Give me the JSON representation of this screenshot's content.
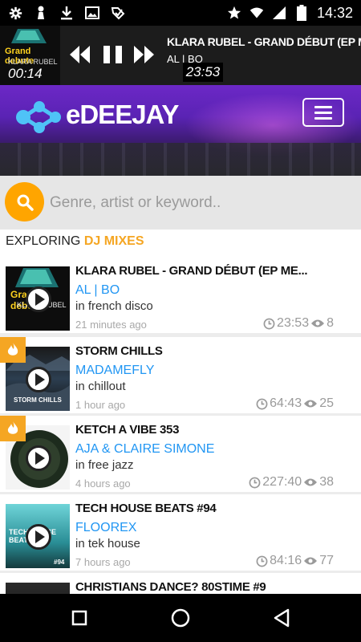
{
  "status_bar": {
    "time": "14:32"
  },
  "player": {
    "art_title": "Grand debute",
    "art_artist": "KLARA RUBEL",
    "elapsed": "00:14",
    "title": "KLARA RUBEL - GRAND DÉBUT (EP MEGAMIX)",
    "artist": "AL | BO",
    "duration": "23:53"
  },
  "header": {
    "logo_text": "eDEEJAY"
  },
  "search": {
    "placeholder": "Genre, artist or keyword.."
  },
  "exploring": {
    "prefix": "EXPLORING ",
    "category": "DJ MIXES"
  },
  "mixes": [
    {
      "title": "KLARA RUBEL - GRAND DÉBUT (EP ME...",
      "artist": "AL | BO",
      "genre": "in french disco",
      "ago": "21 minutes ago",
      "duration": "23:53",
      "plays": "8",
      "hot": false,
      "thumb_top": "Grand debute",
      "thumb_sub": "KLARA RUBEL"
    },
    {
      "title": "STORM CHILLS",
      "artist": "MADAMEFLY",
      "genre": "in chillout",
      "ago": "1 hour ago",
      "duration": "64:43",
      "plays": "25",
      "hot": true,
      "thumb_top": "",
      "thumb_sub": "STORM CHILLS"
    },
    {
      "title": "KETCH A VIBE 353",
      "artist": "AJA & CLAIRE SIMONE",
      "genre": "in free jazz",
      "ago": "4 hours ago",
      "duration": "227:40",
      "plays": "38",
      "hot": true,
      "thumb_top": "",
      "thumb_sub": ""
    },
    {
      "title": "TECH HOUSE BEATS #94",
      "artist": "FLOOREX",
      "genre": "in tek house",
      "ago": "7 hours ago",
      "duration": "84:16",
      "plays": "77",
      "hot": false,
      "thumb_top": "TECH HOUSE BEATS",
      "thumb_sub": "#94"
    },
    {
      "title": "CHRISTIANS DANCE? 80STIME #9",
      "artist": "",
      "genre": "",
      "ago": "",
      "duration": "",
      "plays": "",
      "hot": false,
      "thumb_top": "",
      "thumb_sub": ""
    }
  ],
  "colors": {
    "accent": "#f5a623",
    "link": "#2196f3",
    "header": "#5a23b4"
  }
}
